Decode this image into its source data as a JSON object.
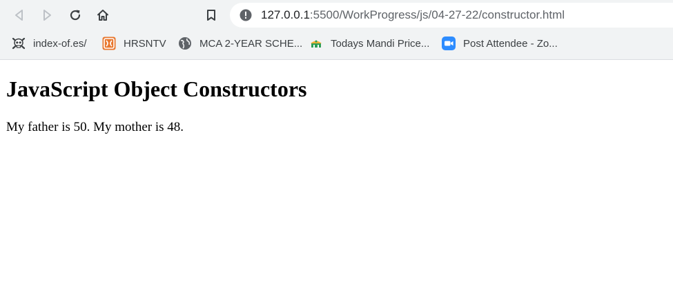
{
  "browser": {
    "url_host": "127.0.0.1",
    "url_rest": ":5500/WorkProgress/js/04-27-22/constructor.html",
    "icons": {
      "back": "back-arrow-icon",
      "forward": "forward-arrow-icon",
      "reload": "reload-icon",
      "home": "home-icon",
      "bookmark": "bookmark-icon",
      "site_info": "info-icon"
    }
  },
  "bookmarks": [
    {
      "label": "index-of.es/",
      "icon": "skull-icon"
    },
    {
      "label": "HRSNTV",
      "icon": "hrsntv-icon"
    },
    {
      "label": "MCA 2-YEAR SCHE...",
      "icon": "globe-icon"
    },
    {
      "label": "Todays Mandi Price...",
      "icon": "mandi-icon"
    },
    {
      "label": "Post Attendee - Zo...",
      "icon": "zoom-icon"
    }
  ],
  "page": {
    "heading": "JavaScript Object Constructors",
    "text": "My father is 50. My mother is 48."
  },
  "colors": {
    "chrome_bg": "#f1f3f4",
    "omnibox_bg": "#ffffff",
    "icon_gray": "#5f6368",
    "zoom_blue": "#2d8cff",
    "hrsntv_orange": "#e8772e"
  }
}
